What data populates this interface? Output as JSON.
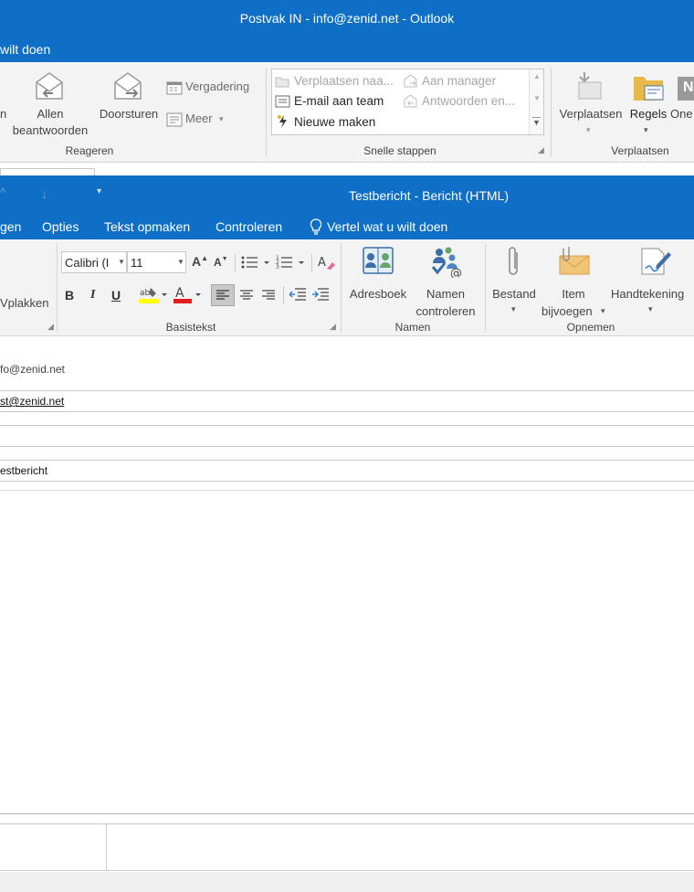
{
  "main_window": {
    "title": "Postvak IN - info@zenid.net - Outlook",
    "tell_me": "wilt doen",
    "ribbon": {
      "reply_all": {
        "line1": "Allen",
        "line2": "beantwoorden",
        "left_fragment": "n"
      },
      "forward": "Doorsturen",
      "meeting": "Vergadering",
      "more": "Meer",
      "group_reply": "Reageren",
      "quick_steps": [
        "Verplaatsen naa...",
        "Aan manager",
        "E-mail aan team",
        "Antwoorden en...",
        "Nieuwe maken"
      ],
      "group_quick_steps": "Snelle stappen",
      "move": "Verplaatsen",
      "rules": "Regels",
      "onenote": "One",
      "group_move": "Verplaatsen"
    }
  },
  "message_window": {
    "title": "Testbericht - Bericht (HTML)",
    "tabs": [
      "gen",
      "Opties",
      "Tekst opmaken",
      "Controleren"
    ],
    "tell_me": "Vertel wat u wilt doen",
    "ribbon": {
      "paste": "Vplakken",
      "font_name": "Calibri (I",
      "font_size": "11",
      "group_basic_text": "Basistekst",
      "address_book": "Adresboek",
      "check_names": {
        "line1": "Namen",
        "line2": "controleren"
      },
      "group_names": "Namen",
      "attach_file": "Bestand",
      "attach_item": {
        "line1": "Item",
        "line2": "bijvoegen"
      },
      "signature": "Handtekening",
      "group_include": "Opnemen"
    },
    "fields": {
      "from": "fo@zenid.net",
      "to": "st@zenid.net",
      "cc": "",
      "bcc": "",
      "subject": "estbericht"
    },
    "body": ""
  },
  "colors": {
    "title_bar": "#0f6fc6",
    "ribbon": "#f3f3f3"
  }
}
